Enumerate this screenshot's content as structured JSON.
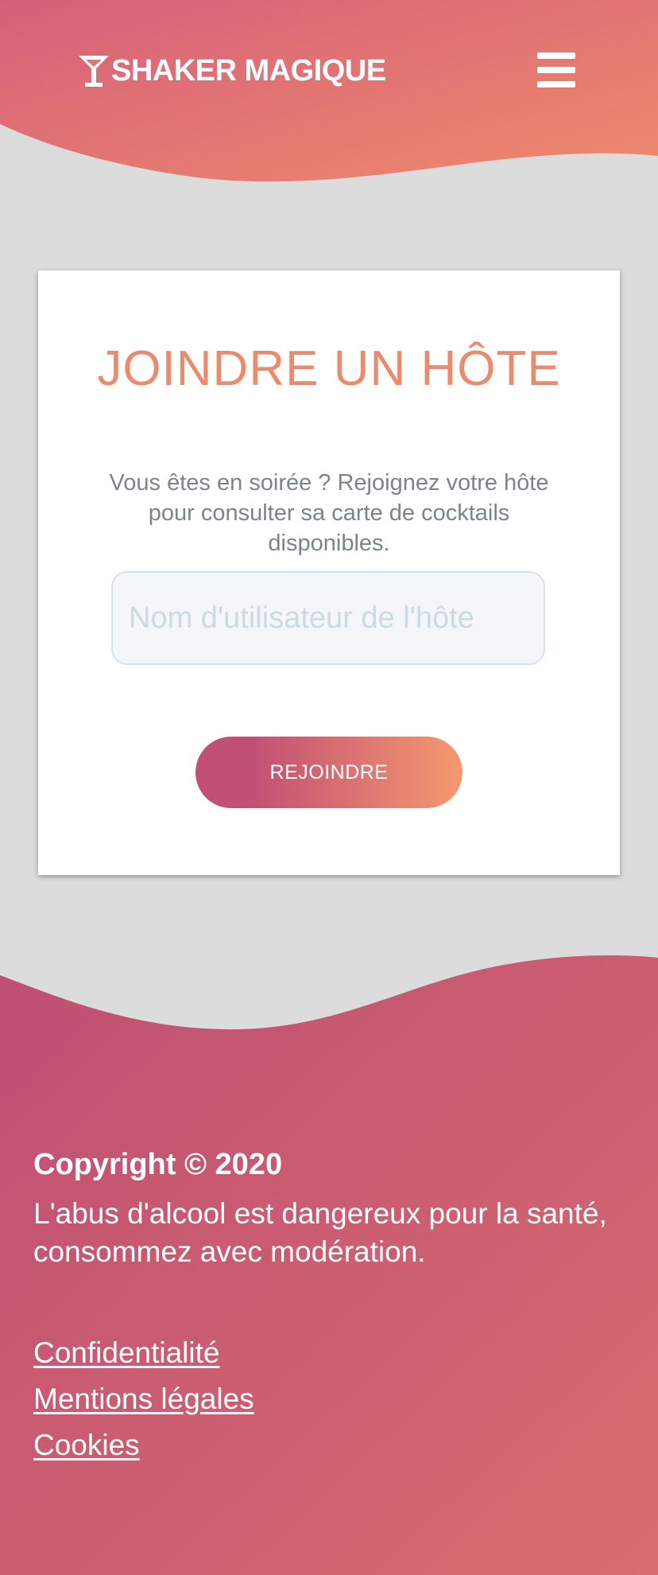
{
  "header": {
    "brand": "SHAKER MAGIQUE",
    "brand_icon": "cocktail-glass-icon",
    "menu_icon": "hamburger-menu-icon",
    "gradient": [
      "#d5607a",
      "#ef8a6c"
    ]
  },
  "card": {
    "title": "JOINDRE UN HÔTE",
    "description": "Vous êtes en soirée ? Rejoignez votre hôte pour consulter sa carte de cocktails disponibles.",
    "input": {
      "value": "",
      "placeholder": "Nom d'utilisateur de l'hôte"
    },
    "button_label": "REJOINDRE",
    "title_color": "#ec8b6b"
  },
  "footer": {
    "copyright": "Copyright © 2020",
    "disclaimer": "L'abus d'alcool est dangereux pour la santé, consommez avec modération.",
    "links": [
      "Confidentialité",
      "Mentions légales",
      "Cookies"
    ],
    "gradient": [
      "#bf4f74",
      "#d86c6e"
    ]
  }
}
